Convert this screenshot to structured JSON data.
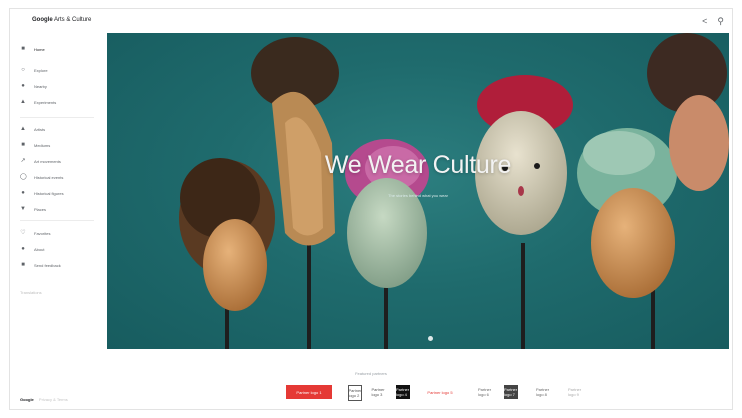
{
  "header": {
    "brand_google": "Google",
    "brand_product": "Arts & Culture",
    "share_icon": "share-icon",
    "search_icon": "search-icon"
  },
  "sidebar": {
    "items": [
      {
        "label": "Home",
        "icon": "home-icon",
        "active": true
      },
      {
        "label": "Explore",
        "icon": "explore-icon"
      },
      {
        "label": "Nearby",
        "icon": "nearby-icon"
      },
      {
        "label": "Experiments",
        "icon": "experiments-icon"
      },
      {
        "label": "Artists",
        "icon": "artists-icon"
      },
      {
        "label": "Mediums",
        "icon": "mediums-icon"
      },
      {
        "label": "Art movements",
        "icon": "art-movements-icon"
      },
      {
        "label": "Historical events",
        "icon": "historical-events-icon"
      },
      {
        "label": "Historical figures",
        "icon": "historical-figures-icon"
      },
      {
        "label": "Places",
        "icon": "places-icon"
      },
      {
        "label": "Favorites",
        "icon": "favorites-icon"
      },
      {
        "label": "About",
        "icon": "about-icon"
      },
      {
        "label": "Send feedback",
        "icon": "feedback-icon"
      }
    ],
    "footnote": "Translations",
    "footer_brand": "Google",
    "footer_text": "Privacy & Terms"
  },
  "hero": {
    "title": "We Wear Culture",
    "subtitle": "The stories behind what you wear"
  },
  "partners": {
    "label": "Featured partners",
    "logos": [
      "Partner logo 1",
      "Partner logo 2",
      "Partner logo 3",
      "Partner logo 4",
      "Partner logo 5",
      "Partner logo 6",
      "Partner logo 7",
      "Partner logo 8",
      "Partner logo 9"
    ],
    "accent_red": "#e53935"
  }
}
